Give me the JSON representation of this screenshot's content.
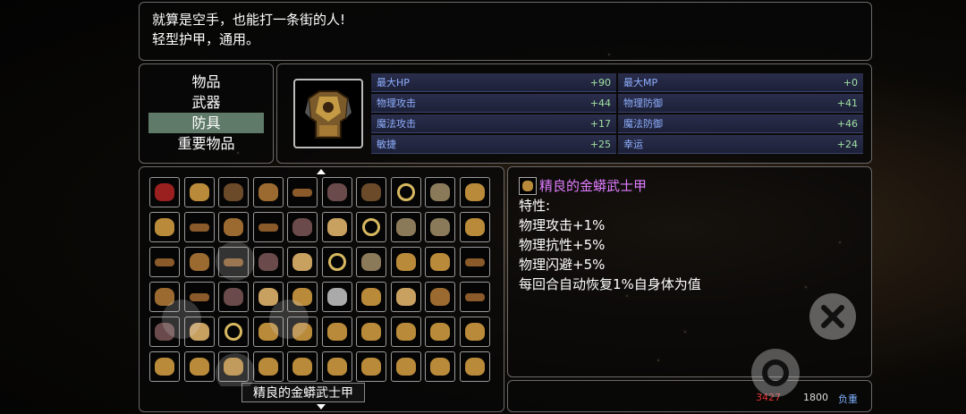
{
  "description": {
    "line1": "就算是空手，也能打一条街的人!",
    "line2": "轻型护甲，通用。"
  },
  "categories": [
    {
      "label": "物品",
      "selected": false
    },
    {
      "label": "武器",
      "selected": false
    },
    {
      "label": "防具",
      "selected": true
    },
    {
      "label": "重要物品",
      "selected": false
    }
  ],
  "stats": [
    {
      "label": "最大HP",
      "value": "+90"
    },
    {
      "label": "最大MP",
      "value": "+0"
    },
    {
      "label": "物理攻击",
      "value": "+44"
    },
    {
      "label": "物理防御",
      "value": "+41"
    },
    {
      "label": "魔法攻击",
      "value": "+17"
    },
    {
      "label": "魔法防御",
      "value": "+46"
    },
    {
      "label": "敏捷",
      "value": "+25"
    },
    {
      "label": "幸运",
      "value": "+24"
    }
  ],
  "selected_item": {
    "name": "精良的金蟒武士甲",
    "icon": "golden-armor-icon"
  },
  "detail": {
    "title": "精良的金蟒武士甲",
    "header": "特性:",
    "traits": [
      "物理攻击+1%",
      "物理抗性+5%",
      "物理闪避+5%",
      "每回合自动恢复1%自身体为值"
    ]
  },
  "footer": {
    "count": "3427",
    "capacity": "1800",
    "weight_label": "负重"
  },
  "inventory_rows": [
    [
      "hat-icon",
      "armor-icon",
      "gloves-icon",
      "gauntlet-icon",
      "belt-icon",
      "boots-icon",
      "gloves-icon",
      "ring-icon",
      "shield-icon",
      "armor-icon"
    ],
    [
      "armor-icon",
      "belt-icon",
      "gauntlet-icon",
      "belt-icon",
      "boots-icon",
      "necklace-icon",
      "ring-icon",
      "shield-icon",
      "shield-icon",
      "armor-icon"
    ],
    [
      "belt-icon",
      "gauntlet-icon",
      "belt-icon",
      "boots-icon",
      "necklace-icon",
      "ring-icon",
      "shield-icon",
      "armor-icon",
      "armor-icon",
      "belt-icon"
    ],
    [
      "gauntlet-icon",
      "belt-icon",
      "boots-icon",
      "necklace-icon",
      "armor-icon",
      "helmet-icon",
      "armor-icon",
      "necklace-icon",
      "gauntlet-icon",
      "belt-icon"
    ],
    [
      "boots-icon",
      "necklace-icon",
      "ring-icon",
      "armor-icon",
      "armor-icon",
      "armor-icon",
      "armor-icon",
      "armor-icon",
      "armor-icon",
      "armor-icon"
    ],
    [
      "armor-icon",
      "armor-icon",
      "armor-icon",
      "armor-icon",
      "armor-icon",
      "armor-icon",
      "armor-icon",
      "armor-icon",
      "armor-icon",
      "armor-icon"
    ]
  ],
  "colors": {
    "highlight": "#5f7a68",
    "stat_label": "#8fb0ff",
    "stat_value": "#9fe0a0",
    "title_purple": "#e07cff",
    "gold": "#c49a44"
  }
}
